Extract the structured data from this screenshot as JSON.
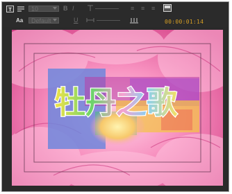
{
  "toolbar": {
    "font_size_value": "10",
    "font_name_value": "Default",
    "timecode": "00:00:01:14"
  },
  "title_text": "牡丹之歌",
  "colors": {
    "accent_timecode": "#d8a024",
    "panel_bg": "#2b2b2b",
    "peony_pink": "#ee6fa6",
    "band_blue": "#6c7ed8",
    "band_magenta": "#c83aa0",
    "band_yellow": "#f2d24a",
    "band_red": "#e04048"
  },
  "icons": [
    "text-icon",
    "list-icon",
    "text-style-icon",
    "bold-icon",
    "italic-icon",
    "underline-icon",
    "height-icon",
    "width-icon",
    "align-left-icon",
    "align-center-icon",
    "align-right-icon",
    "preview-icon",
    "spacing-icon"
  ]
}
